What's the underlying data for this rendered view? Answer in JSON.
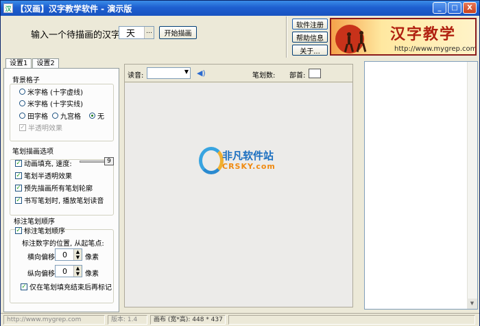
{
  "window": {
    "title": "【汉画】汉字教学软件 - 演示版",
    "app_icon": "汉"
  },
  "titlebar_buttons": {
    "minimize": "_",
    "maximize": "□",
    "close": "X"
  },
  "top": {
    "prompt": "输入一个待描画的汉字:",
    "char_value": "天",
    "char_dropdown": "…",
    "start_button": "开始描画",
    "register_button": "软件注册",
    "help_button": "帮助信息",
    "about_button": "关于..."
  },
  "banner": {
    "title": "汉字教学",
    "url": "http://www.mygrep.com"
  },
  "tabs": [
    "设置1",
    "设置2"
  ],
  "background_grid": {
    "group_label": "背景格子",
    "options": [
      "米字格 (十字虚线)",
      "米字格 (十字实线)",
      "田字格",
      "九宫格",
      "无"
    ],
    "selected": "无",
    "translucent_label": "半透明效果",
    "translucent_checked": true,
    "translucent_enabled": false
  },
  "stroke_options": {
    "group_label": "笔划描画选项",
    "anim_fill_label": "动画填充, 速度:",
    "anim_fill_checked": true,
    "speed_value": "9",
    "stroke_translucent_label": "笔划半透明效果",
    "stroke_translucent_checked": true,
    "prerender_label": "预先描画所有笔划轮廓",
    "prerender_checked": true,
    "sound_label": "书写笔划时, 播放笔划读音",
    "sound_checked": true
  },
  "stroke_order": {
    "group_label": "标注笔划顺序",
    "mark_label": "标注笔划顺序",
    "mark_checked": true,
    "position_label": "标注数字的位置, 从起笔点:",
    "h_offset_label": "横向偏移:",
    "h_offset_value": "0",
    "v_offset_label": "纵向偏移:",
    "v_offset_value": "0",
    "unit": "像素",
    "after_fill_label": "仅在笔划填充结束后再标记",
    "after_fill_checked": true
  },
  "center": {
    "pronunciation_label": "读音:",
    "pronunciation_value": "",
    "stroke_count_label": "笔划数:",
    "radical_label": "部首:",
    "watermark_cn": "非凡软件站",
    "watermark_en": "CRSKY.com"
  },
  "status": {
    "url": "http://www.mygrep.com",
    "version": "版本: 1.4",
    "canvas_size": "画布 (宽*高): 448 * 437"
  }
}
